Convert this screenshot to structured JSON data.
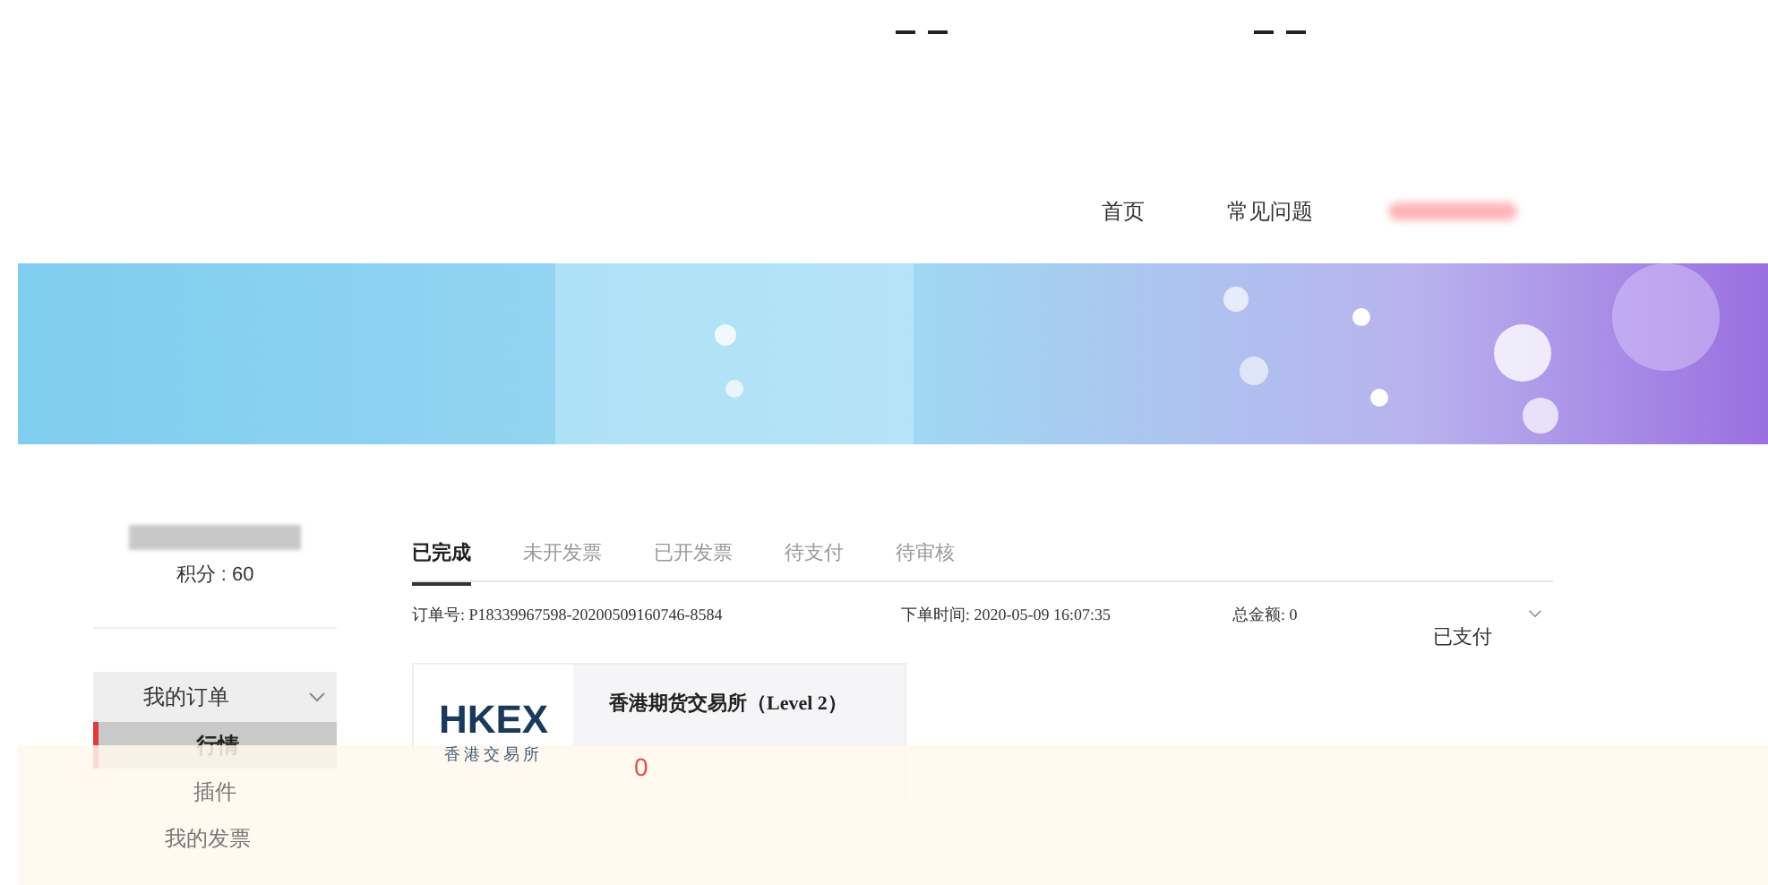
{
  "nav": {
    "items": [
      {
        "label": "首页"
      },
      {
        "label": "常见问题"
      }
    ]
  },
  "sidebar": {
    "points": "积分 : 60",
    "menu": {
      "label": "我的订单",
      "expanded": true,
      "children": [
        {
          "label": "行情",
          "selected": true
        },
        {
          "label": "插件",
          "selected": false
        }
      ]
    },
    "items": [
      {
        "label": "我的发票"
      }
    ]
  },
  "tabs": [
    {
      "label": "已完成",
      "selected": true
    },
    {
      "label": "未开发票",
      "selected": false
    },
    {
      "label": "已开发票",
      "selected": false
    },
    {
      "label": "待支付",
      "selected": false
    },
    {
      "label": "待审核",
      "selected": false
    }
  ],
  "order": {
    "number": "订单号: P18339967598-20200509160746-8584",
    "time": "下单时间: 2020-05-09 16:07:35",
    "total": "总金额: 0",
    "status": "已支付",
    "product": {
      "logo_text": "HKEX",
      "logo_subtext": "香港交易所",
      "name": "香港期货交易所（Level 2）",
      "price": "0"
    }
  }
}
